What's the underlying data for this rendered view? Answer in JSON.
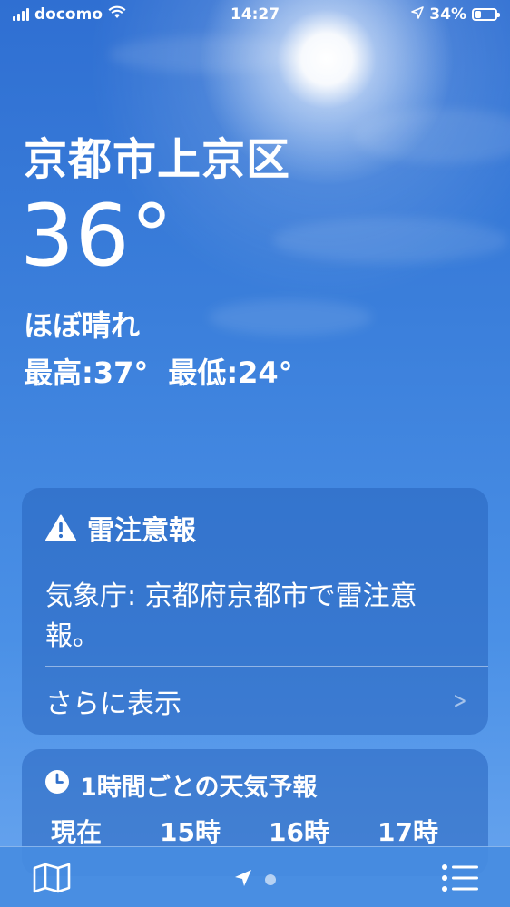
{
  "status_bar": {
    "carrier": "docomo",
    "time": "14:27",
    "battery_percent": "34%",
    "battery_level": 0.34,
    "icons": [
      "signal-icon",
      "wifi-icon",
      "location-arrow-icon",
      "battery-icon"
    ]
  },
  "weather": {
    "location": "京都市上京区",
    "temperature": "36°",
    "condition": "ほぼ晴れ",
    "high": "最高:37°",
    "low": "最低:24°"
  },
  "alert": {
    "icon": "warning-icon",
    "title": "雷注意報",
    "body": "気象庁: 京都府京都市で雷注意報。",
    "more_label": "さらに表示",
    "more_icon": "chevron-right-icon"
  },
  "hourly": {
    "icon": "clock-icon",
    "title": "1時間ごとの天気予報",
    "hours": [
      "現在",
      "15時",
      "16時",
      "17時"
    ]
  },
  "toolbar": {
    "icons": [
      "map-icon",
      "location-arrow-icon",
      "list-icon"
    ]
  },
  "colors": {
    "sky_top": "#2f6fd2",
    "sky_bottom": "#6aa6ef",
    "card_bg": "rgba(40,100,190,0.55)",
    "text": "#ffffff"
  }
}
